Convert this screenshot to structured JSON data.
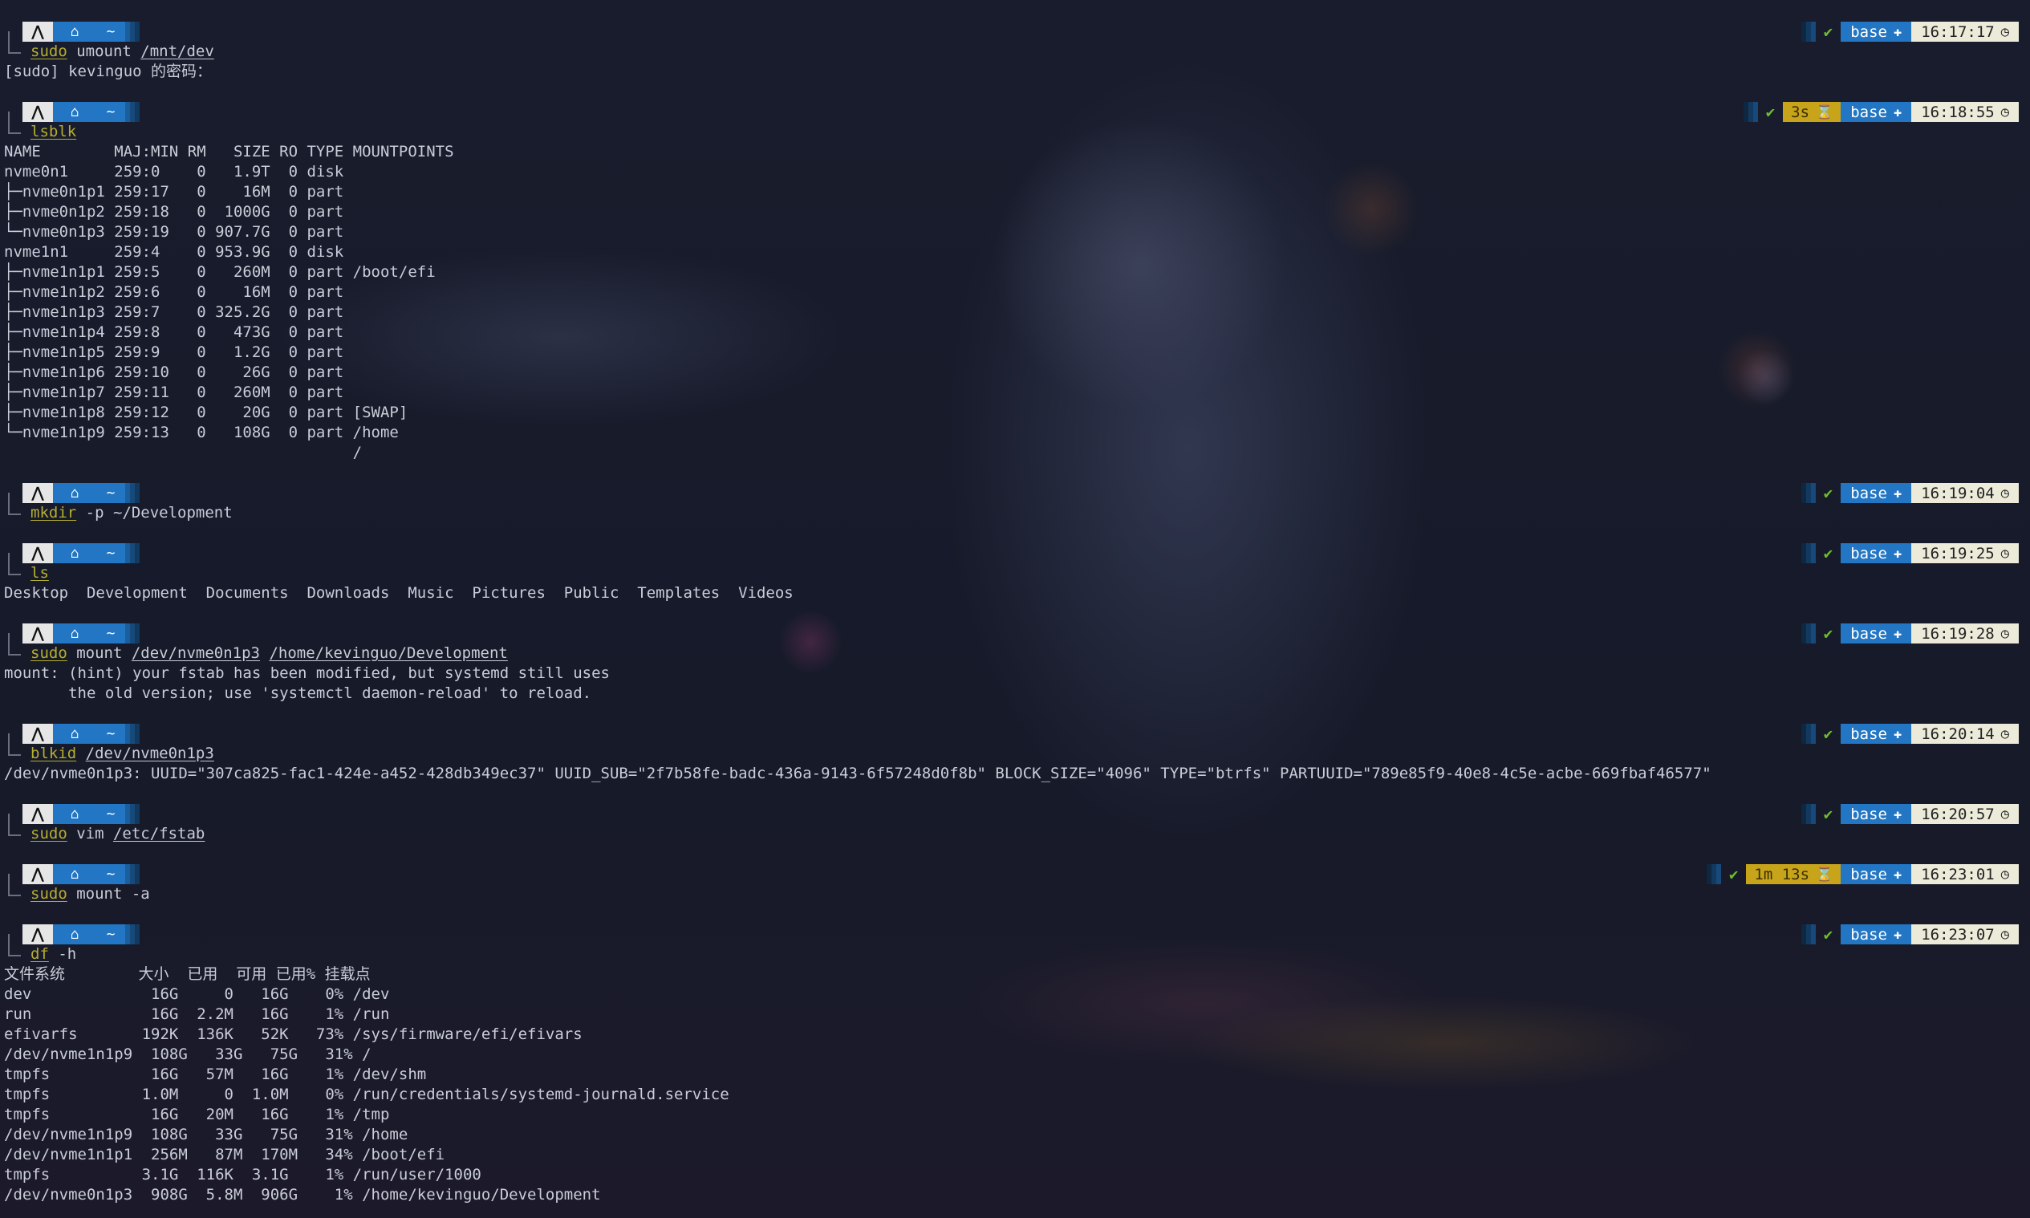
{
  "prompt": {
    "os_glyph": "⋀",
    "home_glyph": "⌂",
    "dir": "~"
  },
  "theme": {
    "accent": "#2276c4",
    "command_ok": "#b6ae2f",
    "duration_bg": "#c8a41a",
    "time_bg": "#ecead8",
    "check": "#6fbf2a"
  },
  "blocks": [
    {
      "cmd": [
        {
          "t": "sudo",
          "c": "ok"
        },
        {
          "t": " umount ",
          "c": "arg"
        },
        {
          "t": "/mnt/dev",
          "c": "path"
        }
      ],
      "status": {
        "check": "✔",
        "duration": "",
        "env": "base",
        "time": "16:17:17"
      },
      "output": [
        "[sudo] kevinguo 的密码："
      ]
    },
    {
      "cmd": [
        {
          "t": "lsblk",
          "c": "ok"
        }
      ],
      "status": {
        "check": "✔",
        "duration": "3s",
        "env": "base",
        "time": "16:18:55"
      },
      "output": [
        "NAME        MAJ:MIN RM   SIZE RO TYPE MOUNTPOINTS",
        "nvme0n1     259:0    0   1.9T  0 disk",
        "├─nvme0n1p1 259:17   0    16M  0 part",
        "├─nvme0n1p2 259:18   0  1000G  0 part",
        "└─nvme0n1p3 259:19   0 907.7G  0 part",
        "nvme1n1     259:4    0 953.9G  0 disk",
        "├─nvme1n1p1 259:5    0   260M  0 part /boot/efi",
        "├─nvme1n1p2 259:6    0    16M  0 part",
        "├─nvme1n1p3 259:7    0 325.2G  0 part",
        "├─nvme1n1p4 259:8    0   473G  0 part",
        "├─nvme1n1p5 259:9    0   1.2G  0 part",
        "├─nvme1n1p6 259:10   0    26G  0 part",
        "├─nvme1n1p7 259:11   0   260M  0 part",
        "├─nvme1n1p8 259:12   0    20G  0 part [SWAP]",
        "└─nvme1n1p9 259:13   0   108G  0 part /home",
        "                                      /"
      ]
    },
    {
      "cmd": [
        {
          "t": "mkdir",
          "c": "ok"
        },
        {
          "t": " -p ~/Development",
          "c": "arg"
        }
      ],
      "status": {
        "check": "✔",
        "duration": "",
        "env": "base",
        "time": "16:19:04"
      },
      "output": []
    },
    {
      "cmd": [
        {
          "t": "ls",
          "c": "ok"
        }
      ],
      "status": {
        "check": "✔",
        "duration": "",
        "env": "base",
        "time": "16:19:25"
      },
      "output": [
        "Desktop  Development  Documents  Downloads  Music  Pictures  Public  Templates  Videos"
      ]
    },
    {
      "cmd": [
        {
          "t": "sudo",
          "c": "ok"
        },
        {
          "t": " mount ",
          "c": "arg"
        },
        {
          "t": "/dev/nvme0n1p3",
          "c": "path"
        },
        {
          "t": " ",
          "c": "arg"
        },
        {
          "t": "/home/kevinguo/Development",
          "c": "path"
        }
      ],
      "status": {
        "check": "✔",
        "duration": "",
        "env": "base",
        "time": "16:19:28"
      },
      "output": [
        "mount: (hint) your fstab has been modified, but systemd still uses",
        "       the old version; use 'systemctl daemon-reload' to reload."
      ]
    },
    {
      "cmd": [
        {
          "t": "blkid",
          "c": "ok"
        },
        {
          "t": " ",
          "c": "arg"
        },
        {
          "t": "/dev/nvme0n1p3",
          "c": "path"
        }
      ],
      "status": {
        "check": "✔",
        "duration": "",
        "env": "base",
        "time": "16:20:14"
      },
      "output": [
        "/dev/nvme0n1p3: UUID=\"307ca825-fac1-424e-a452-428db349ec37\" UUID_SUB=\"2f7b58fe-badc-436a-9143-6f57248d0f8b\" BLOCK_SIZE=\"4096\" TYPE=\"btrfs\" PARTUUID=\"789e85f9-40e8-4c5e-acbe-669fbaf46577\""
      ]
    },
    {
      "cmd": [
        {
          "t": "sudo",
          "c": "ok"
        },
        {
          "t": " vim ",
          "c": "arg"
        },
        {
          "t": "/etc/fstab",
          "c": "path"
        }
      ],
      "status": {
        "check": "✔",
        "duration": "",
        "env": "base",
        "time": "16:20:57"
      },
      "output": []
    },
    {
      "cmd": [
        {
          "t": "sudo",
          "c": "ok"
        },
        {
          "t": " mount -a",
          "c": "arg"
        }
      ],
      "status": {
        "check": "✔",
        "duration": "1m 13s",
        "env": "base",
        "time": "16:23:01"
      },
      "output": []
    },
    {
      "cmd": [
        {
          "t": "df",
          "c": "ok"
        },
        {
          "t": " -h",
          "c": "arg"
        }
      ],
      "status": {
        "check": "✔",
        "duration": "",
        "env": "base",
        "time": "16:23:07"
      },
      "output": [
        "文件系统        大小  已用  可用 已用% 挂载点",
        "dev             16G     0   16G    0% /dev",
        "run             16G  2.2M   16G    1% /run",
        "efivarfs       192K  136K   52K   73% /sys/firmware/efi/efivars",
        "/dev/nvme1n1p9  108G   33G   75G   31% /",
        "tmpfs           16G   57M   16G    1% /dev/shm",
        "tmpfs          1.0M     0  1.0M    0% /run/credentials/systemd-journald.service",
        "tmpfs           16G   20M   16G    1% /tmp",
        "/dev/nvme1n1p9  108G   33G   75G   31% /home",
        "/dev/nvme1n1p1  256M   87M  170M   34% /boot/efi",
        "tmpfs          3.1G  116K  3.1G    1% /run/user/1000",
        "/dev/nvme0n1p3  908G  5.8M  906G    1% /home/kevinguo/Development"
      ]
    }
  ]
}
